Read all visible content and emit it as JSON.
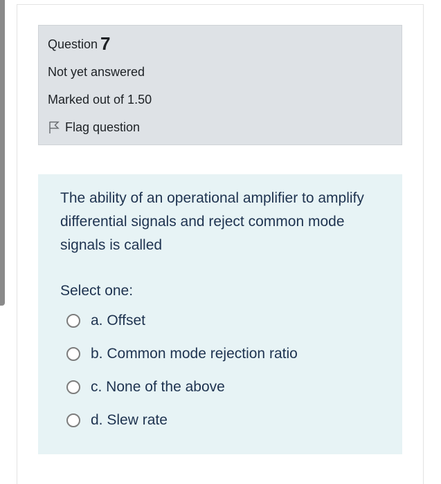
{
  "info": {
    "question_label": "Question",
    "question_number": "7",
    "state": "Not yet answered",
    "grade": "Marked out of 1.50",
    "flag_label": "Flag question"
  },
  "content": {
    "question_text": "The ability of an operational amplifier to amplify differential signals and reject common mode signals is called",
    "prompt": "Select one:",
    "answers": [
      {
        "label": "a. Offset"
      },
      {
        "label": "b. Common mode rejection ratio"
      },
      {
        "label": "c. None of the above"
      },
      {
        "label": "d. Slew rate"
      }
    ]
  },
  "icons": {
    "flag": "flag-outline-icon",
    "radio": "radio-unchecked"
  }
}
